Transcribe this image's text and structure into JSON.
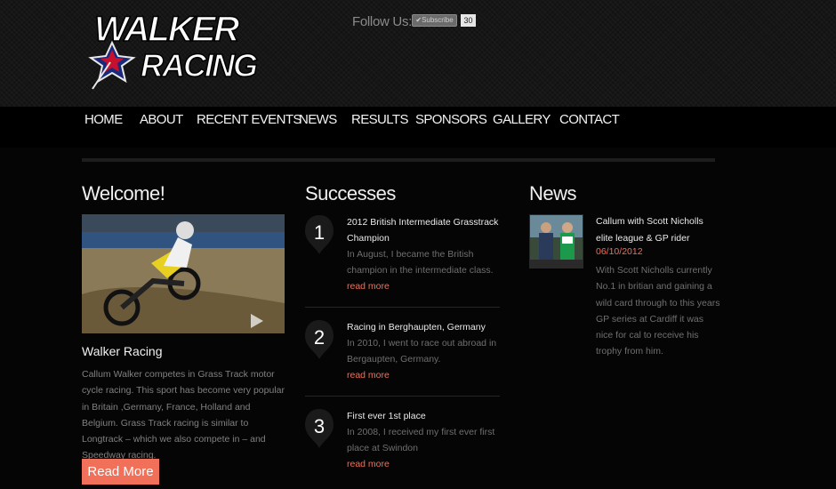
{
  "logo": {
    "line1": "WALKER",
    "line2": "RACING"
  },
  "social": {
    "follow_label": "Follow Us:",
    "like_label": "Subscribe",
    "like_count": "30"
  },
  "nav": {
    "items": [
      {
        "label": "HOME"
      },
      {
        "label": "ABOUT"
      },
      {
        "label": "RECENT EVENTS"
      },
      {
        "label": "NEWS"
      },
      {
        "label": "RESULTS"
      },
      {
        "label": "SPONSORS"
      },
      {
        "label": "GALLERY"
      },
      {
        "label": "CONTACT"
      }
    ]
  },
  "welcome": {
    "title": "Welcome!",
    "heading": "Walker Racing",
    "text": "Callum Walker competes in Grass Track motor cycle racing. This sport has become very popular in Britain ,Germany, France, Holland and Belgium. Grass Track racing is similar to Longtrack – which we also compete in – and Speedway racing.",
    "button": "Read More"
  },
  "successes": {
    "title": "Successes",
    "items": [
      {
        "number": "1",
        "title": "2012 British Intermediate Grasstrack Champion",
        "desc": "In August, I became the British champion in the intermediate class.",
        "link": "read more"
      },
      {
        "number": "2",
        "title": "Racing in Berghaupten, Germany",
        "desc": "In 2010, I went to race out abroad in Bergaupten, Germany.",
        "link": "read more"
      },
      {
        "number": "3",
        "title": "First ever 1st place",
        "desc": "In 2008, I received my first ever first place at Swindon",
        "link": "read more"
      }
    ]
  },
  "news": {
    "title": "News",
    "item": {
      "title": "Callum with Scott Nicholls elite league & GP rider",
      "date": "06/10/2012",
      "body": "With Scott Nicholls currently No.1 in britian and gaining a wild card through to this years GP series at Cardiff it was nice for cal to receive his trophy from him."
    }
  },
  "colors": {
    "accent": "#f0705a",
    "background": "#050505",
    "header_bg": "#161616"
  }
}
